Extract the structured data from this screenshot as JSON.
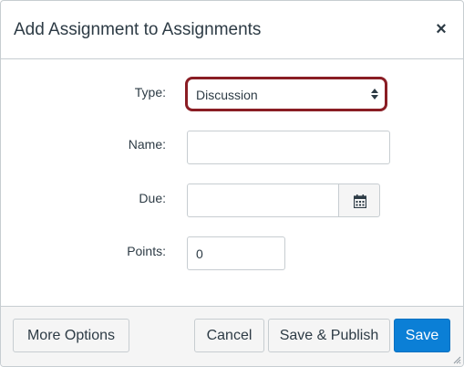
{
  "dialog": {
    "title": "Add Assignment to Assignments",
    "close_symbol": "×"
  },
  "form": {
    "type_label": "Type:",
    "type_value": "Discussion",
    "name_label": "Name:",
    "name_value": "",
    "due_label": "Due:",
    "due_value": "",
    "points_label": "Points:",
    "points_value": "0"
  },
  "footer": {
    "more_options": "More Options",
    "cancel": "Cancel",
    "save_publish": "Save & Publish",
    "save": "Save"
  },
  "colors": {
    "highlight_border": "#8a1d24",
    "primary_button": "#0b7fd6",
    "footer_bg": "#f5f5f5"
  },
  "icons": [
    "close-icon",
    "select-arrows-icon",
    "calendar-icon",
    "resize-grip-icon"
  ]
}
